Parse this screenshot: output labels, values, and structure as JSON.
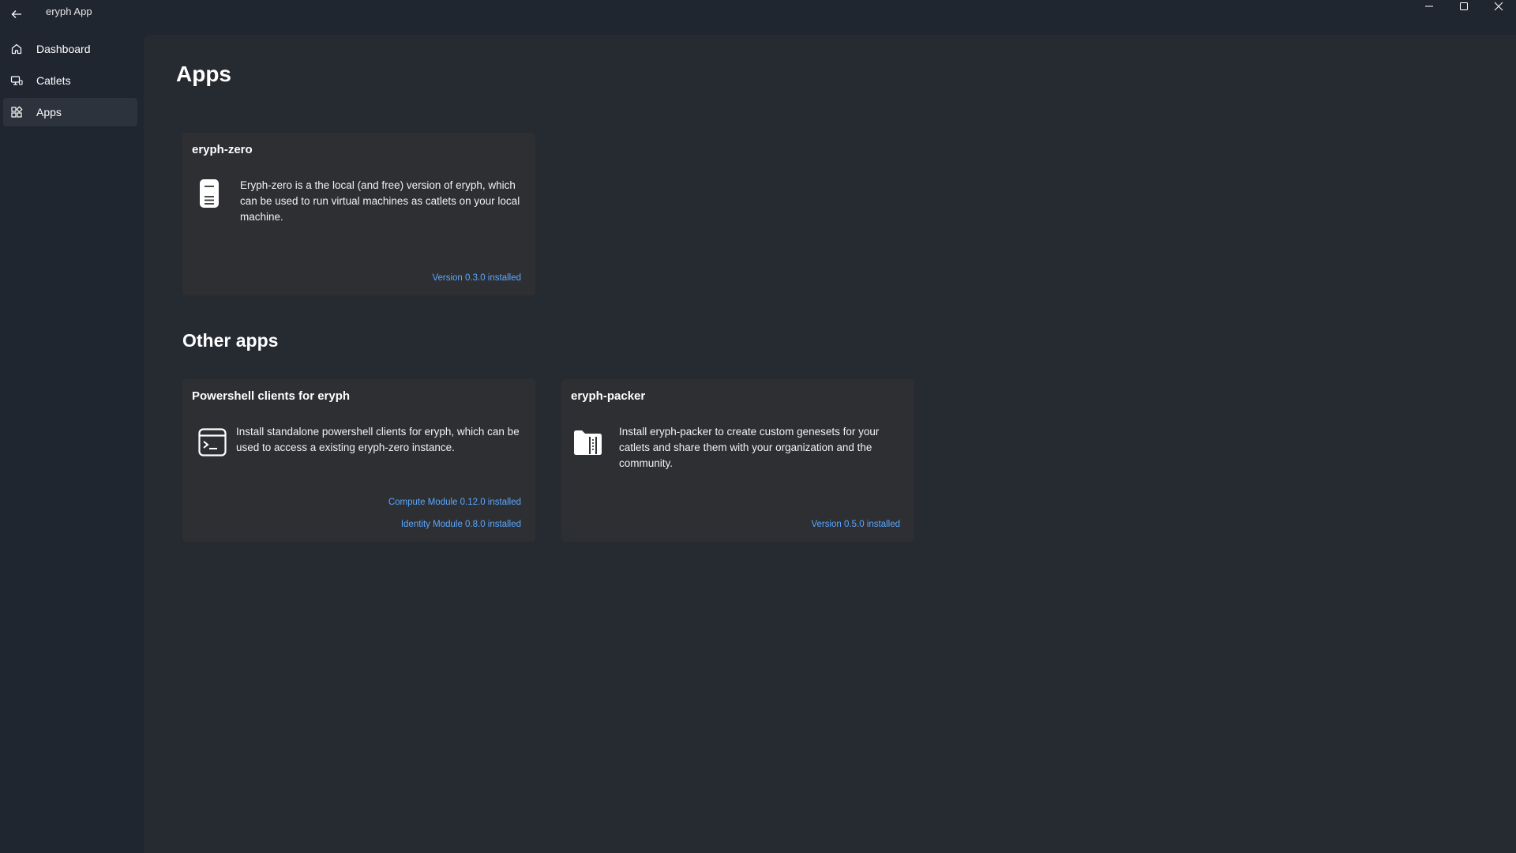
{
  "window": {
    "title": "eryph App",
    "back_icon": "back-arrow-icon",
    "controls": [
      "minimize-icon",
      "maximize-icon",
      "close-icon"
    ]
  },
  "sidebar": {
    "items": [
      {
        "label": "Dashboard",
        "icon": "home-icon",
        "selected": false
      },
      {
        "label": "Catlets",
        "icon": "catlets-icon",
        "selected": false
      },
      {
        "label": "Apps",
        "icon": "apps-icon",
        "selected": true
      }
    ]
  },
  "main": {
    "title": "Apps",
    "installed_cards": [
      {
        "title": "eryph-zero",
        "icon": "server-icon",
        "description": "Eryph-zero is a the local (and free) version of eryph, which can be used to run virtual machines as catlets on your local machine.",
        "links": [
          "Version 0.3.0 installed"
        ]
      }
    ],
    "other_section_title": "Other apps",
    "other_cards": [
      {
        "title": "Powershell clients for eryph",
        "icon": "terminal-icon",
        "description": "Install standalone powershell clients for eryph, which can be used to access a existing eryph-zero instance.",
        "links": [
          "Compute Module 0.12.0 installed",
          "Identity Module 0.8.0 installed"
        ]
      },
      {
        "title": "eryph-packer",
        "icon": "package-icon",
        "description": "Install eryph-packer to create custom genesets for your catlets and share them with your organization and the community.",
        "links": [
          "Version 0.5.0 installed"
        ]
      }
    ]
  },
  "colors": {
    "sidebar_bg": "#1f2630",
    "content_bg": "#262a31",
    "card_bg": "#2e2f32",
    "link": "#5aa8ff"
  }
}
